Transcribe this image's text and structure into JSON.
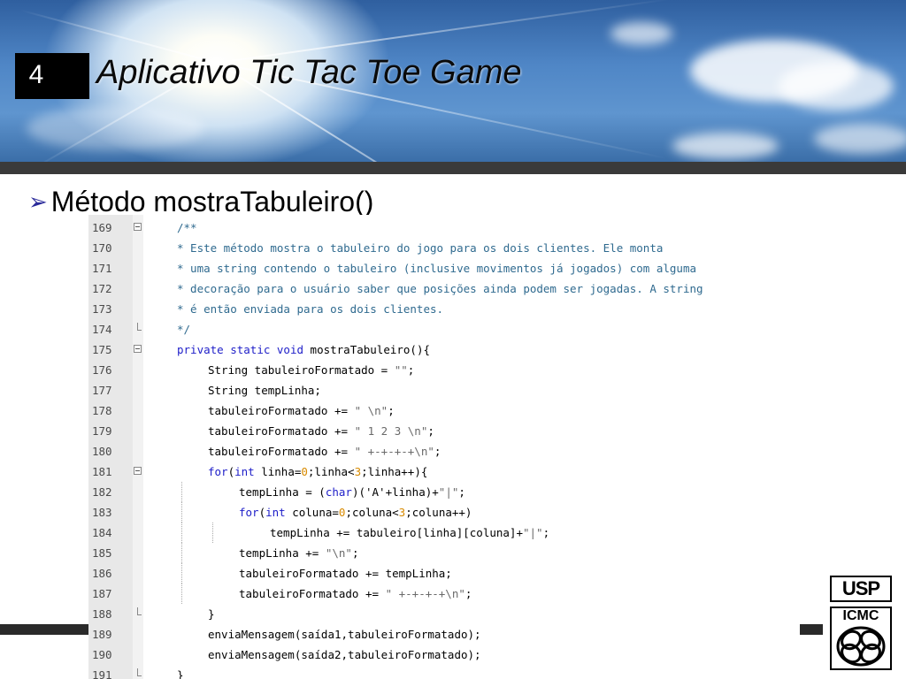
{
  "slide": {
    "number": "4",
    "title": "Aplicativo Tic Tac Toe Game"
  },
  "bullet": {
    "marker": "arrow-bullet-icon",
    "text": "Método mostraTabuleiro()"
  },
  "logos": {
    "usp": "USP",
    "icmc": "ICMC"
  },
  "code": {
    "lines": [
      {
        "n": "169",
        "text": "/**"
      },
      {
        "n": "170",
        "text": "* Este método mostra o tabuleiro do jogo para os dois clientes. Ele monta"
      },
      {
        "n": "171",
        "text": "* uma string contendo o tabuleiro (inclusive movimentos já jogados) com alguma"
      },
      {
        "n": "172",
        "text": "* decoração para o usuário saber que posições ainda podem ser jogadas. A string"
      },
      {
        "n": "173",
        "text": "* é então enviada para os dois clientes."
      },
      {
        "n": "174",
        "text": "*/"
      },
      {
        "n": "175",
        "text": "private static void mostraTabuleiro(){"
      },
      {
        "n": "176",
        "text": "String tabuleiroFormatado = \"\";"
      },
      {
        "n": "177",
        "text": "String tempLinha;"
      },
      {
        "n": "178",
        "text": "tabuleiroFormatado += \" \\n\";"
      },
      {
        "n": "179",
        "text": "tabuleiroFormatado += \" 1 2 3 \\n\";"
      },
      {
        "n": "180",
        "text": "tabuleiroFormatado += \" +-+-+-+\\n\";"
      },
      {
        "n": "181",
        "text": "for(int linha=0;linha<3;linha++){"
      },
      {
        "n": "182",
        "text": "tempLinha = (char)('A'+linha)+\"|\";"
      },
      {
        "n": "183",
        "text": "for(int coluna=0;coluna<3;coluna++)"
      },
      {
        "n": "184",
        "text": "tempLinha += tabuleiro[linha][coluna]+\"|\";"
      },
      {
        "n": "185",
        "text": "tempLinha += \"\\n\";"
      },
      {
        "n": "186",
        "text": "tabuleiroFormatado += tempLinha;"
      },
      {
        "n": "187",
        "text": "tabuleiroFormatado += \" +-+-+-+\\n\";"
      },
      {
        "n": "188",
        "text": "}"
      },
      {
        "n": "189",
        "text": "enviaMensagem(saída1,tabuleiroFormatado);"
      },
      {
        "n": "190",
        "text": "enviaMensagem(saída2,tabuleiroFormatado);"
      },
      {
        "n": "191",
        "text": "}"
      }
    ]
  }
}
